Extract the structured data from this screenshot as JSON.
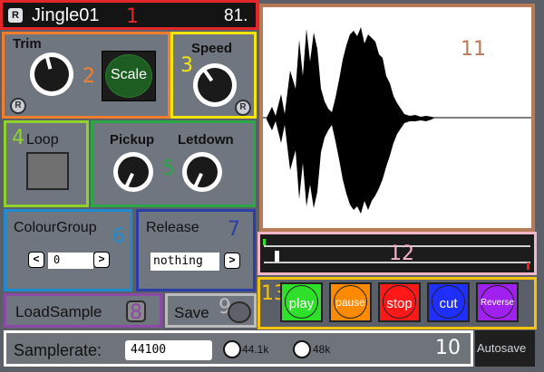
{
  "header": {
    "r_badge": "R",
    "title": "Jingle01",
    "value": "81.",
    "region_number": "1"
  },
  "trim": {
    "label": "Trim",
    "scale_label": "Scale",
    "reset_label": "R",
    "region_number": "2"
  },
  "speed": {
    "label": "Speed",
    "reset_label": "R",
    "region_number": "3"
  },
  "loop": {
    "label": "Loop",
    "region_number": "4"
  },
  "pickup": {
    "label": "Pickup",
    "region_number": "5"
  },
  "letdown": {
    "label": "Letdown"
  },
  "colour_group": {
    "label": "ColourGroup",
    "value": "0",
    "prev": "<",
    "next": ">",
    "region_number": "6"
  },
  "release": {
    "label": "Release",
    "value": "nothing",
    "next": ">",
    "region_number": "7"
  },
  "load_sample": {
    "label": "LoadSample",
    "region_number": "8"
  },
  "save": {
    "label": "Save",
    "region_number": "9"
  },
  "samplerate": {
    "label": "Samplerate:",
    "value": "44100",
    "opt1": "44.1k",
    "opt2": "48k",
    "region_number": "10"
  },
  "autosave": {
    "label": "Autosave"
  },
  "waveform": {
    "region_number": "11"
  },
  "timeline": {
    "region_number": "12"
  },
  "transport": {
    "region_number": "13",
    "play": "play",
    "pause": "pause",
    "stop": "stop",
    "cut": "cut",
    "reverse": "Reverse",
    "colors": {
      "play": "#2ee02a",
      "pause": "#ff8a00",
      "stop": "#ff1818",
      "cut": "#1f2fff",
      "reverse": "#a020f0"
    }
  },
  "region_colors": {
    "r1": "#e2262a",
    "r2": "#f47e2c",
    "r3": "#f5e50e",
    "r4": "#8fd32a",
    "r5": "#2aa848",
    "r6": "#1e8bd0",
    "r7": "#2b3ea8",
    "r8": "#8a4aa6",
    "r9": "#bcbcbc",
    "r10": "#ffffff",
    "r11": "#b97a57",
    "r12": "#f3b6c6",
    "r13": "#f5c20e"
  }
}
